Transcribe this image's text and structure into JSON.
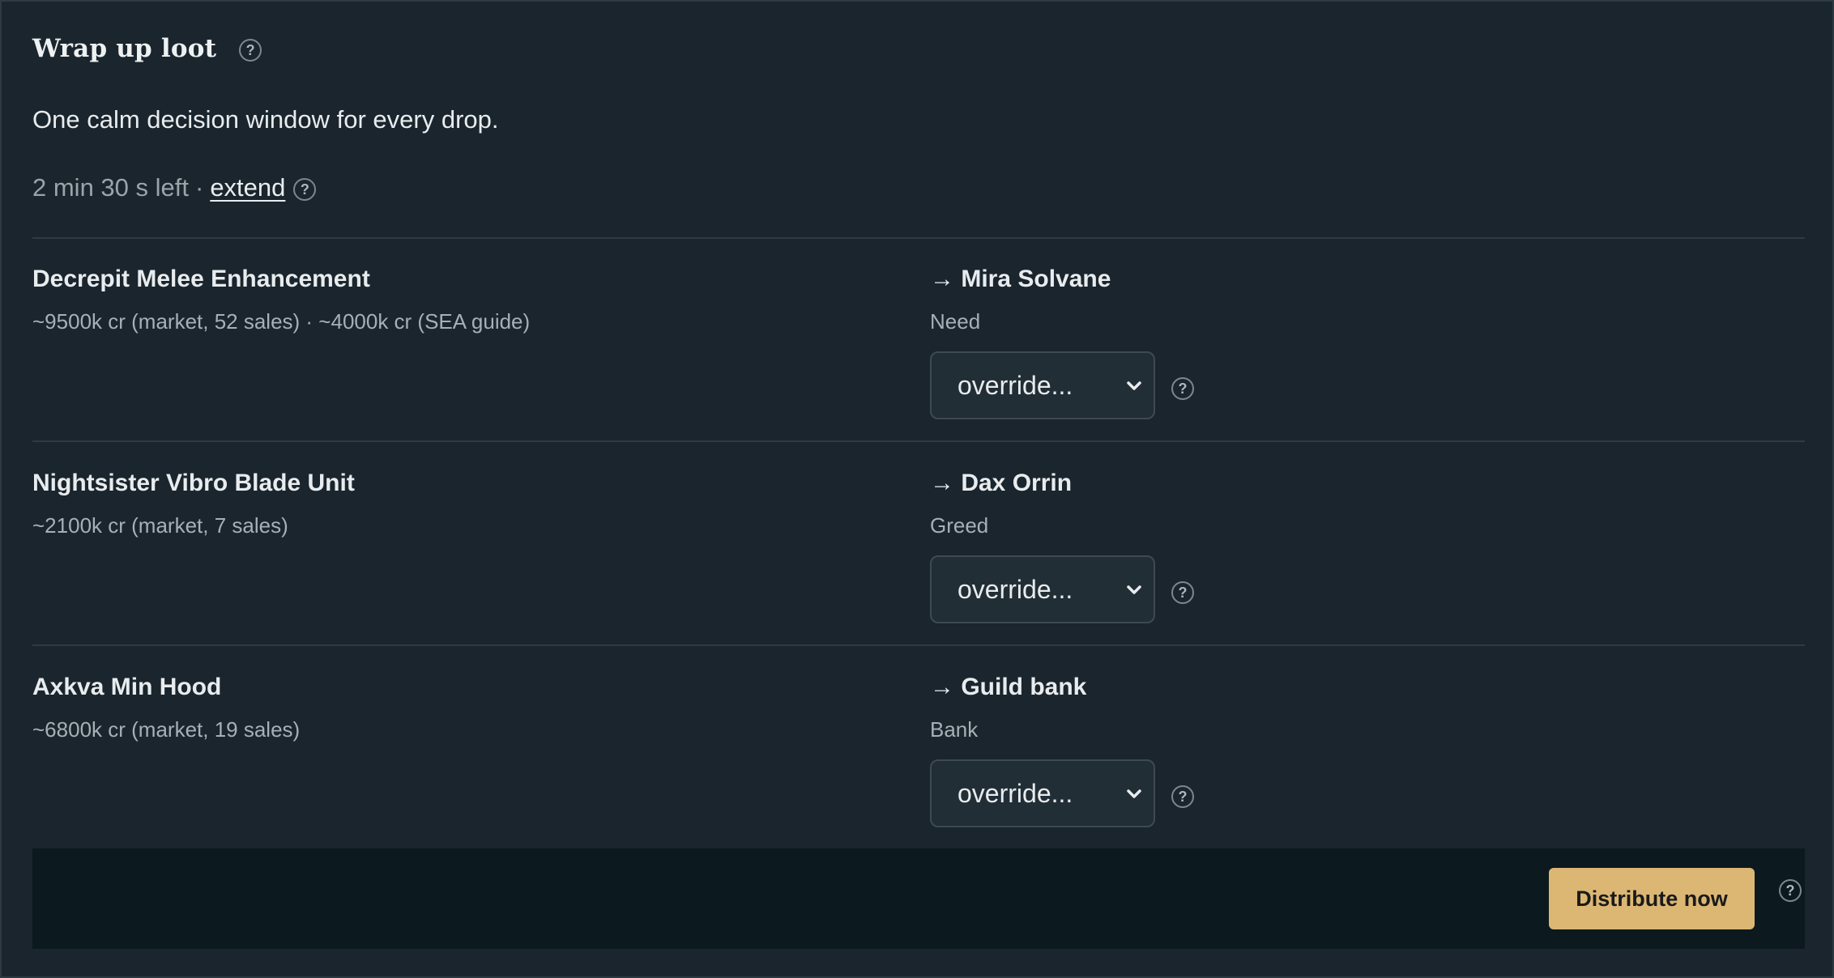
{
  "header": {
    "title": "Wrap up loot",
    "help": "?"
  },
  "subtitle": "One calm decision window for every drop.",
  "timer": {
    "remaining": "2 min 30 s left",
    "separator": "·",
    "extend_label": "extend",
    "help": "?"
  },
  "items": [
    {
      "name": "Decrepit Melee Enhancement",
      "price": "~9500k cr (market, 52 sales) · ~4000k cr (SEA guide)",
      "assignee": "→ Mira Solvane",
      "reason": "Need",
      "override_label": "override...",
      "help": "?"
    },
    {
      "name": "Nightsister Vibro Blade Unit",
      "price": "~2100k cr (market, 7 sales)",
      "assignee": "→ Dax Orrin",
      "reason": "Greed",
      "override_label": "override...",
      "help": "?"
    },
    {
      "name": "Axkva Min Hood",
      "price": "~6800k cr (market, 19 sales)",
      "assignee": "→ Guild bank",
      "reason": "Bank",
      "override_label": "override...",
      "help": "?"
    }
  ],
  "footer": {
    "distribute_label": "Distribute now",
    "help": "?"
  },
  "colors": {
    "background": "#1a252d",
    "footer_bg": "#0c1a1f",
    "accent_button": "#dcb774",
    "muted_text": "#a6b0b6"
  },
  "icons": {
    "help": "question-circle-icon",
    "dropdown": "chevron-down-icon"
  }
}
